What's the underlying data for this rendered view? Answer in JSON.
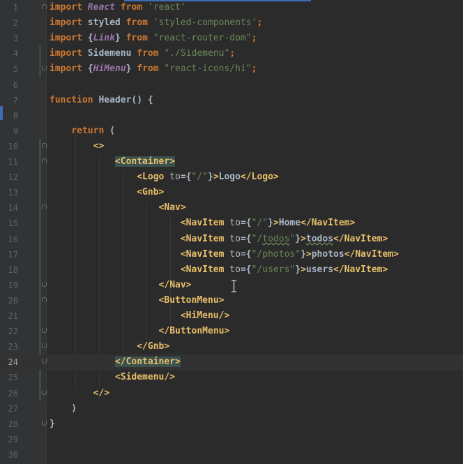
{
  "editor": {
    "lines": [
      {
        "n": "1",
        "tokens": [
          [
            "kw",
            "import "
          ],
          [
            "it",
            "React "
          ],
          [
            "kw",
            "from "
          ],
          [
            "str",
            "'react'"
          ]
        ]
      },
      {
        "n": "2",
        "tokens": [
          [
            "kw",
            "import "
          ],
          [
            "txt",
            "styled "
          ],
          [
            "kw",
            "from "
          ],
          [
            "str",
            "'styled-components'"
          ],
          [
            "kw",
            ";"
          ]
        ]
      },
      {
        "n": "3",
        "tokens": [
          [
            "kw",
            "import "
          ],
          [
            "txt",
            "{"
          ],
          [
            "it",
            "Link"
          ],
          [
            "txt",
            "} "
          ],
          [
            "kw",
            "from "
          ],
          [
            "str",
            "\"react-router-dom\""
          ],
          [
            "kw",
            ";"
          ]
        ]
      },
      {
        "n": "4",
        "tokens": [
          [
            "kw",
            "import "
          ],
          [
            "txt",
            "Sidemenu "
          ],
          [
            "kw",
            "from "
          ],
          [
            "str",
            "\"./Sidemenu\""
          ],
          [
            "kw",
            ";"
          ]
        ]
      },
      {
        "n": "5",
        "tokens": [
          [
            "kw",
            "import "
          ],
          [
            "txt",
            "{"
          ],
          [
            "it",
            "HiMenu"
          ],
          [
            "txt",
            "} "
          ],
          [
            "kw",
            "from "
          ],
          [
            "str",
            "\"react-icons/hi\""
          ],
          [
            "kw",
            ";"
          ]
        ]
      },
      {
        "n": "6",
        "tokens": []
      },
      {
        "n": "7",
        "tokens": [
          [
            "kw",
            "function "
          ],
          [
            "txt",
            "Header() {"
          ]
        ]
      },
      {
        "n": "8",
        "tokens": []
      },
      {
        "n": "9",
        "tokens": [
          [
            "txt",
            "    "
          ],
          [
            "kw",
            "return "
          ],
          [
            "txt",
            "("
          ]
        ]
      },
      {
        "n": "10",
        "tokens": [
          [
            "txt",
            "        "
          ],
          [
            "tag",
            "<>"
          ]
        ]
      },
      {
        "n": "11",
        "tokens": [
          [
            "txt",
            "            "
          ],
          [
            "tag hl",
            "<Container>"
          ]
        ]
      },
      {
        "n": "12",
        "tokens": [
          [
            "txt",
            "                "
          ],
          [
            "tag",
            "<Logo "
          ],
          [
            "attr",
            "to"
          ],
          [
            "txt",
            "={"
          ],
          [
            "str",
            "\"/\""
          ],
          [
            "txt",
            "}"
          ],
          [
            "tag",
            ">"
          ],
          [
            "txt",
            "Logo"
          ],
          [
            "tag",
            "</Logo>"
          ]
        ]
      },
      {
        "n": "13",
        "tokens": [
          [
            "txt",
            "                "
          ],
          [
            "tag",
            "<Gnb>"
          ]
        ]
      },
      {
        "n": "14",
        "tokens": [
          [
            "txt",
            "                    "
          ],
          [
            "tag",
            "<Nav>"
          ]
        ]
      },
      {
        "n": "15",
        "tokens": [
          [
            "txt",
            "                        "
          ],
          [
            "tag",
            "<NavItem "
          ],
          [
            "attr",
            "to"
          ],
          [
            "txt",
            "={"
          ],
          [
            "str",
            "\"/\""
          ],
          [
            "txt",
            "}"
          ],
          [
            "tag",
            ">"
          ],
          [
            "txt",
            "Home"
          ],
          [
            "tag",
            "</NavItem>"
          ]
        ]
      },
      {
        "n": "16",
        "tokens": [
          [
            "txt",
            "                        "
          ],
          [
            "tag",
            "<NavItem "
          ],
          [
            "attr",
            "to"
          ],
          [
            "txt",
            "={"
          ],
          [
            "str",
            "\"/"
          ],
          [
            "str uline",
            "todos"
          ],
          [
            "str",
            "\""
          ],
          [
            "txt",
            "}"
          ],
          [
            "tag",
            ">"
          ],
          [
            "txt uline",
            "todos"
          ],
          [
            "tag",
            "</NavItem>"
          ]
        ]
      },
      {
        "n": "17",
        "tokens": [
          [
            "txt",
            "                        "
          ],
          [
            "tag",
            "<NavItem "
          ],
          [
            "attr",
            "to"
          ],
          [
            "txt",
            "={"
          ],
          [
            "str",
            "\"/photos\""
          ],
          [
            "txt",
            "}"
          ],
          [
            "tag",
            ">"
          ],
          [
            "txt",
            "photos"
          ],
          [
            "tag",
            "</NavItem>"
          ]
        ]
      },
      {
        "n": "18",
        "tokens": [
          [
            "txt",
            "                        "
          ],
          [
            "tag",
            "<NavItem "
          ],
          [
            "attr",
            "to"
          ],
          [
            "txt",
            "={"
          ],
          [
            "str",
            "\"/users\""
          ],
          [
            "txt",
            "}"
          ],
          [
            "tag",
            ">"
          ],
          [
            "txt",
            "users"
          ],
          [
            "tag",
            "</NavItem>"
          ]
        ]
      },
      {
        "n": "19",
        "tokens": [
          [
            "txt",
            "                    "
          ],
          [
            "tag",
            "</Nav>"
          ]
        ]
      },
      {
        "n": "20",
        "tokens": [
          [
            "txt",
            "                    "
          ],
          [
            "tag",
            "<ButtonMenu>"
          ]
        ]
      },
      {
        "n": "21",
        "tokens": [
          [
            "txt",
            "                        "
          ],
          [
            "tag",
            "<HiMenu/>"
          ]
        ]
      },
      {
        "n": "22",
        "tokens": [
          [
            "txt",
            "                    "
          ],
          [
            "tag",
            "</ButtonMenu>"
          ]
        ]
      },
      {
        "n": "23",
        "tokens": [
          [
            "txt",
            "                "
          ],
          [
            "tag",
            "</Gnb>"
          ]
        ]
      },
      {
        "n": "24",
        "tokens": [
          [
            "txt",
            "            "
          ],
          [
            "tag hl",
            "</Container>"
          ]
        ]
      },
      {
        "n": "25",
        "tokens": [
          [
            "txt",
            "            "
          ],
          [
            "tag",
            "<Sidemenu/>"
          ]
        ]
      },
      {
        "n": "26",
        "tokens": [
          [
            "txt",
            "        "
          ],
          [
            "tag",
            "</>"
          ]
        ]
      },
      {
        "n": "27",
        "tokens": [
          [
            "txt",
            "    )"
          ]
        ]
      },
      {
        "n": "28",
        "tokens": [
          [
            "txt",
            "}"
          ]
        ]
      },
      {
        "n": "29",
        "tokens": []
      },
      {
        "n": "30",
        "tokens": []
      }
    ],
    "current_line": "24",
    "fold_markers": {
      "1": "start",
      "5": "end",
      "10": "start",
      "11": "start",
      "14": "start",
      "19": "end",
      "20": "start",
      "22": "end",
      "23": "end",
      "24": "end",
      "26": "end",
      "28": "end"
    }
  },
  "colors": {
    "background": "#2b2b2b",
    "gutter": "#313335",
    "keyword": "#cc7832",
    "string": "#6a8759",
    "tag": "#e8bf6a",
    "identifier": "#a9b7c6",
    "italic_identifier": "#9876aa",
    "tag_highlight": "#3b514d",
    "current_line": "#323232"
  },
  "icons": {
    "text_cursor": "i-beam-cursor-icon",
    "fold": "code-fold-icon"
  }
}
